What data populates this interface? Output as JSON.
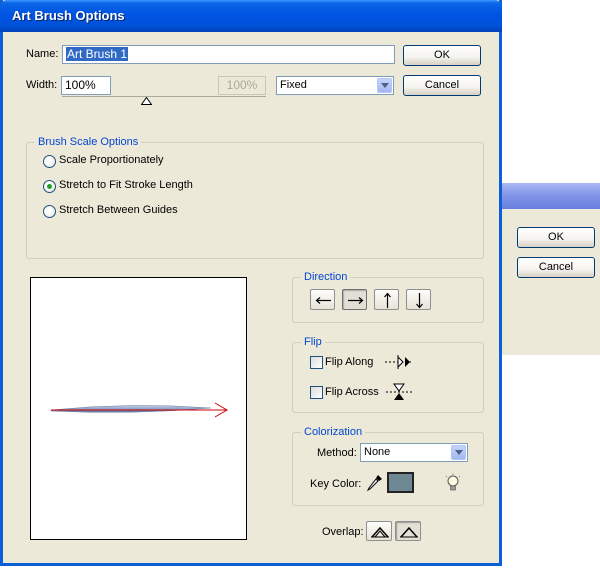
{
  "background_dialog": {
    "ok_label": "OK",
    "cancel_label": "Cancel"
  },
  "window": {
    "title": "Art Brush Options"
  },
  "name_row": {
    "label": "Name:",
    "value": "Art Brush 1"
  },
  "buttons": {
    "ok_label": "OK",
    "cancel_label": "Cancel"
  },
  "width_row": {
    "label": "Width:",
    "value": "100%",
    "max_value": "100%",
    "mode_selected": "Fixed",
    "slider_value_percent": 100
  },
  "brush_scale": {
    "legend": "Brush Scale Options",
    "options": [
      {
        "label": "Scale Proportionately",
        "selected": false
      },
      {
        "label": "Stretch to Fit Stroke Length",
        "selected": true
      },
      {
        "label": "Stretch Between Guides",
        "selected": false
      }
    ]
  },
  "direction": {
    "legend": "Direction",
    "buttons": [
      {
        "icon": "arrow-left-icon",
        "selected": false
      },
      {
        "icon": "arrow-right-icon",
        "selected": true
      },
      {
        "icon": "arrow-up-icon",
        "selected": false
      },
      {
        "icon": "arrow-down-icon",
        "selected": false
      }
    ]
  },
  "flip": {
    "legend": "Flip",
    "along_label": "Flip Along",
    "along_checked": false,
    "across_label": "Flip Across",
    "across_checked": false
  },
  "colorization": {
    "legend": "Colorization",
    "method_label": "Method:",
    "method_selected": "None",
    "key_color_label": "Key Color:",
    "key_color": "#6e8893"
  },
  "overlap": {
    "label": "Overlap:"
  },
  "colors": {
    "title_bar": "#0054e3",
    "dialog_bg": "#ece9d8",
    "group_legend": "#0046d5",
    "selection": "#316ac5",
    "preview_stroke": "#cc0000"
  }
}
